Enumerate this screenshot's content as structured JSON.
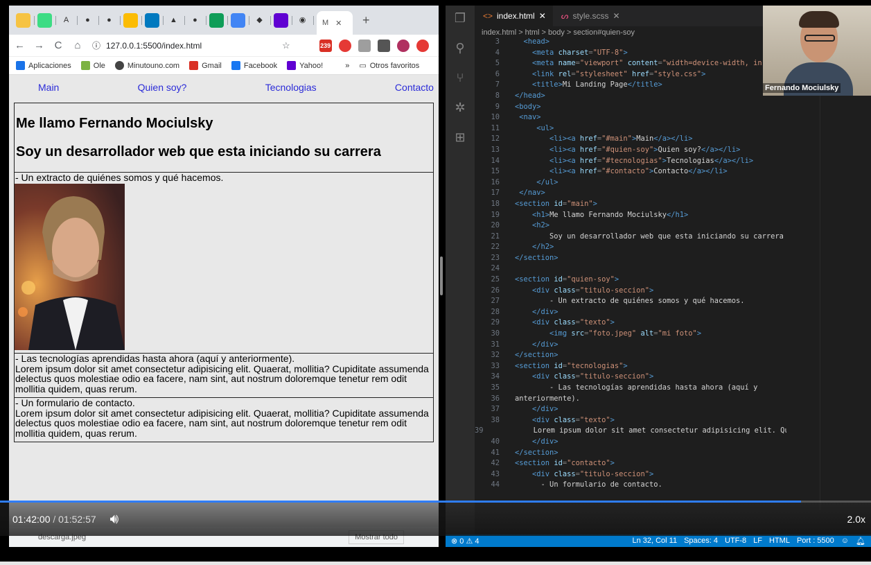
{
  "browser": {
    "tabs": [
      {
        "icon": "chrome-icon"
      },
      {
        "icon": "android-icon"
      },
      {
        "icon": "a-icon"
      },
      {
        "icon": "github-icon"
      },
      {
        "icon": "github-icon"
      },
      {
        "icon": "drive-icon"
      },
      {
        "icon": "trello-icon"
      },
      {
        "icon": "app-icon"
      },
      {
        "icon": "github-icon"
      },
      {
        "icon": "sheets-icon"
      },
      {
        "icon": "app-icon"
      },
      {
        "icon": "app-icon"
      },
      {
        "icon": "mail-icon"
      },
      {
        "icon": "app-icon"
      }
    ],
    "active_tab_label": "M",
    "url": "127.0.0.1:5500/index.html",
    "gmail_count": "239",
    "bookmarks": [
      "Aplicaciones",
      "Ole",
      "Minutouno.com",
      "Gmail",
      "Facebook",
      "Yahoo!"
    ],
    "other_bookmarks": "Otros favoritos"
  },
  "site": {
    "nav": [
      "Main",
      "Quien soy?",
      "Tecnologias",
      "Contacto"
    ],
    "h1": "Me llamo Fernando Mociulsky",
    "h2": "Soy un desarrollador web que esta iniciando su carrera",
    "quien_soy_title": "- Un extracto de quiénes somos y qué hacemos.",
    "tecnologias_title": "- Las tecnologías aprendidas hasta ahora (aquí y anteriormente).",
    "lorem": "Lorem ipsum dolor sit amet consectetur adipisicing elit. Quaerat, mollitia? Cupiditate assumenda delectus quos molestiae odio ea facere, nam sint, aut nostrum doloremque tenetur rem odit mollitia quidem, quas rerum.",
    "contacto_title": "- Un formulario de contacto."
  },
  "editor": {
    "tabs": [
      "index.html",
      "style.scss"
    ],
    "breadcrumb": "index.html > html > body > section#quien-soy",
    "line_start": 3
  },
  "webcam": {
    "name": "Fernando Mociulsky"
  },
  "status": {
    "problems": "⊗ 0 ⚠ 4",
    "position": "Ln 32, Col 11",
    "spaces": "Spaces: 4",
    "encoding": "UTF-8",
    "eol": "LF",
    "language": "HTML",
    "port": "Port : 5500"
  },
  "player": {
    "current": "01:42:00",
    "separator": "/",
    "duration": "01:52:57",
    "progress": 0.92,
    "speed": "2.0x"
  },
  "downloads": {
    "file": "descarga.jpeg",
    "show_all": "Mostrar todo"
  }
}
